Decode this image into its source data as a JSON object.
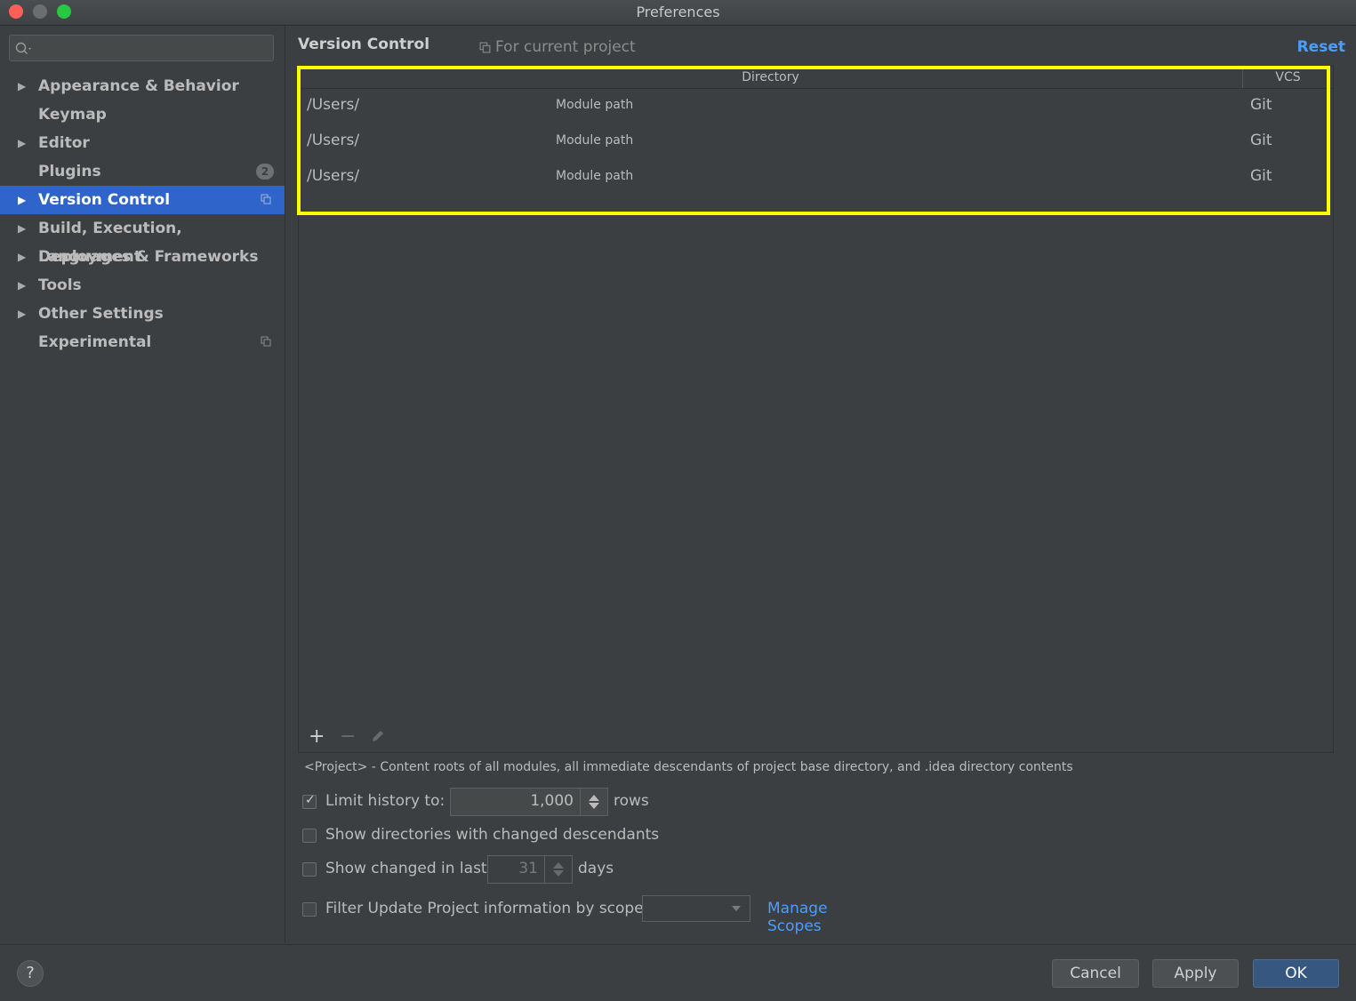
{
  "window": {
    "title": "Preferences"
  },
  "sidebar": {
    "search_placeholder": "",
    "items": [
      {
        "label": "Appearance & Behavior",
        "expandable": true
      },
      {
        "label": "Keymap",
        "expandable": false
      },
      {
        "label": "Editor",
        "expandable": true
      },
      {
        "label": "Plugins",
        "expandable": false,
        "badge": "2"
      },
      {
        "label": "Version Control",
        "expandable": true,
        "selected": true,
        "project_icon": true
      },
      {
        "label": "Build, Execution, Deployment",
        "expandable": true
      },
      {
        "label": "Languages & Frameworks",
        "expandable": true
      },
      {
        "label": "Tools",
        "expandable": true
      },
      {
        "label": "Other Settings",
        "expandable": true
      },
      {
        "label": "Experimental",
        "expandable": false,
        "project_icon": true
      }
    ]
  },
  "main": {
    "title": "Version Control",
    "scope_label": "For current project",
    "reset_label": "Reset",
    "table": {
      "headers": [
        "Directory",
        "VCS"
      ],
      "rows": [
        {
          "path": "/Users/",
          "module": "Module path",
          "vcs": "Git"
        },
        {
          "path": "/Users/",
          "module": "Module path",
          "vcs": "Git"
        },
        {
          "path": "/Users/",
          "module": "Module path",
          "vcs": "Git"
        }
      ]
    },
    "toolbar": {
      "add": "+",
      "remove": "−"
    },
    "description": "<Project> - Content roots of all modules, all immediate descendants of project base directory, and .idea directory contents",
    "options": {
      "limit_history": {
        "label": "Limit history to:",
        "value": "1,000",
        "suffix": "rows",
        "checked": true
      },
      "show_dirs": {
        "label": "Show directories with changed descendants",
        "checked": false
      },
      "show_changed": {
        "label": "Show changed in last",
        "value": "31",
        "suffix": "days",
        "checked": false
      },
      "filter_scope": {
        "label": "Filter Update Project information by scope",
        "checked": false,
        "selected": ""
      },
      "manage_scopes": "Manage Scopes"
    }
  },
  "footer": {
    "help": "?",
    "cancel": "Cancel",
    "apply": "Apply",
    "ok": "OK"
  },
  "colors": {
    "background": "#3c3f41",
    "selection": "#2f65ca",
    "link": "#4a9eff",
    "highlight": "#ffff00",
    "ok_button": "#365880"
  }
}
